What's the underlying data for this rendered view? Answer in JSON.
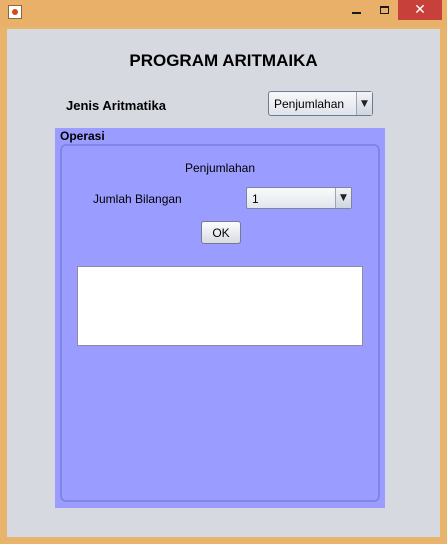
{
  "window": {
    "icon": "java-cup-icon",
    "controls": {
      "minimize_icon": "minimize-icon",
      "maximize_icon": "maximize-icon",
      "close_glyph": "✕"
    }
  },
  "header": {
    "title": "PROGRAM ARITMAIKA"
  },
  "form": {
    "jenis_label": "Jenis Aritmatika",
    "jenis_selected": "Penjumlahan"
  },
  "operasi": {
    "title": "Operasi",
    "mode_label": "Penjumlahan",
    "jumlah_label": "Jumlah Bilangan",
    "jumlah_selected": "1",
    "ok_label": "OK",
    "output_text": ""
  },
  "colors": {
    "frame": "#e8b36a",
    "content_bg": "#d6d9df",
    "panel_bg": "#9a9cff",
    "close_bg": "#c7413a"
  }
}
